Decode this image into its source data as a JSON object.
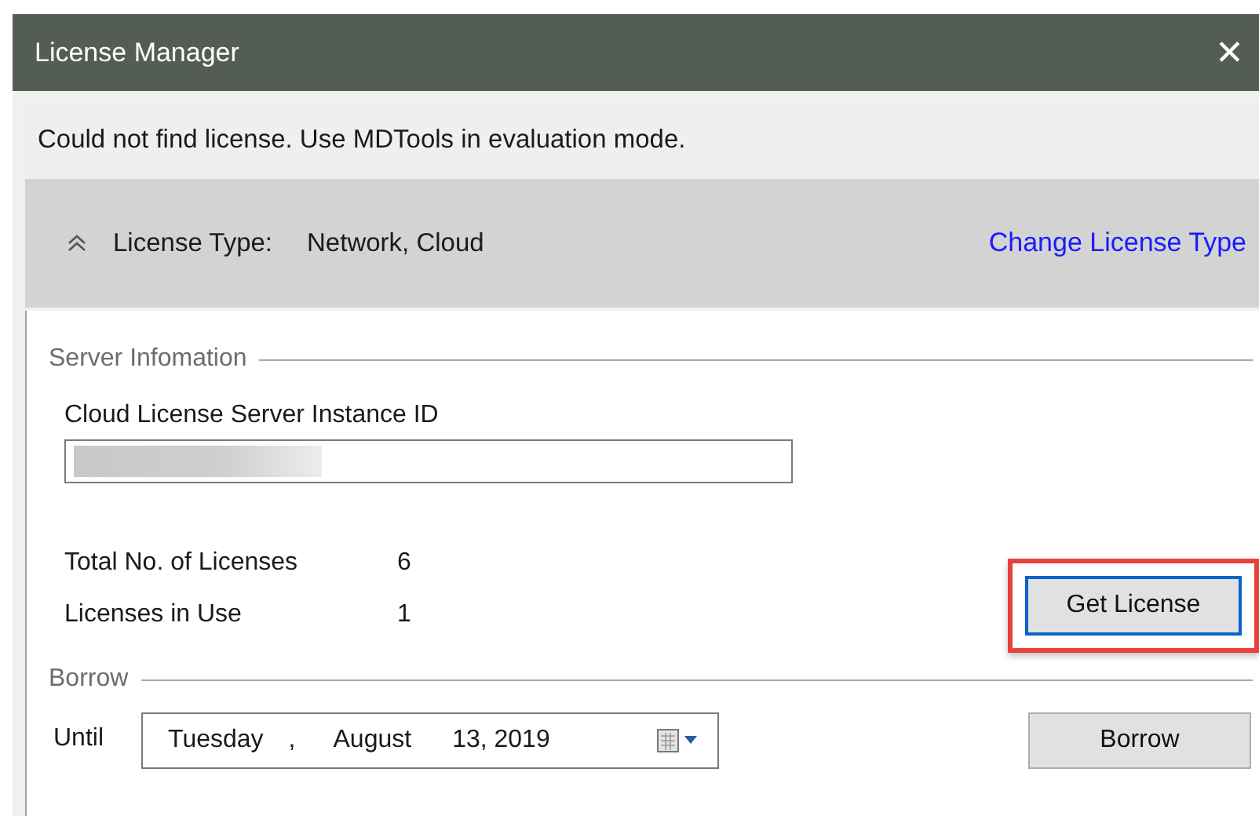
{
  "window": {
    "title": "License Manager",
    "close": "✕"
  },
  "message": "Could not find license. Use MDTools in evaluation mode.",
  "license_type": {
    "expanded": true,
    "label": "License Type:",
    "value": "Network, Cloud",
    "link": "Change License Type"
  },
  "server_information": {
    "legend": "Server Infomation",
    "instance_id_label": "Cloud License Server Instance ID",
    "stats": [
      {
        "label": "Total No. of Licenses",
        "value": "6"
      },
      {
        "label": "Licenses in Use",
        "value": "1"
      }
    ],
    "get_license_button": {
      "label": "Get License",
      "highlighted": true,
      "focused": true
    }
  },
  "borrow": {
    "legend": "Borrow",
    "until_label": "Until",
    "date_parts": [
      "Tuesday",
      ",",
      "August",
      "13, 2019"
    ],
    "button": "Borrow"
  }
}
